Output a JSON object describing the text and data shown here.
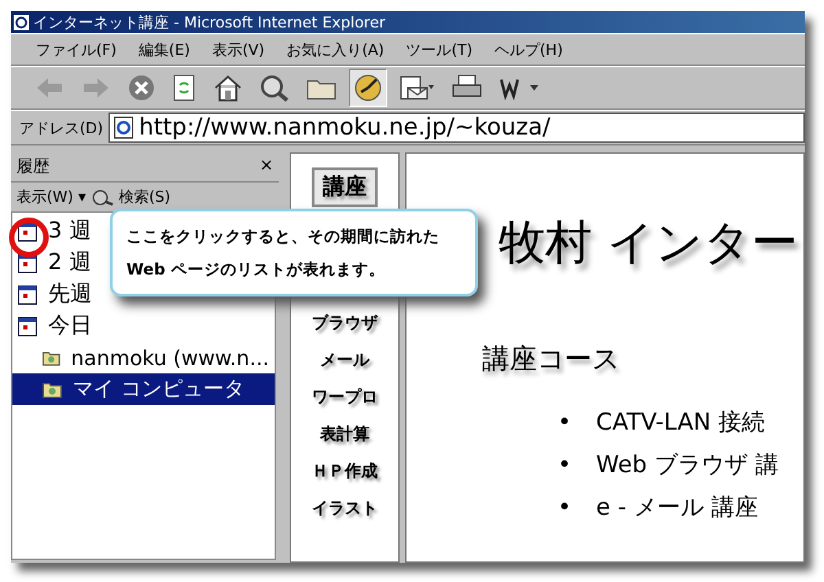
{
  "window": {
    "title": "インターネット講座 - Microsoft Internet Explorer"
  },
  "menu": [
    "ファイル(F)",
    "編集(E)",
    "表示(V)",
    "お気に入り(A)",
    "ツール(T)",
    "ヘルプ(H)"
  ],
  "toolbar": [
    {
      "kind": "back",
      "selected": false
    },
    {
      "kind": "forward",
      "selected": false
    },
    {
      "kind": "stop",
      "selected": false
    },
    {
      "kind": "refresh",
      "selected": false
    },
    {
      "kind": "home",
      "selected": false
    },
    {
      "kind": "search",
      "selected": false
    },
    {
      "kind": "favorites",
      "selected": false
    },
    {
      "kind": "history",
      "selected": true
    },
    {
      "kind": "mail",
      "selected": false
    },
    {
      "kind": "print",
      "selected": false
    },
    {
      "kind": "edit",
      "selected": false
    }
  ],
  "address_bar": {
    "label": "アドレス(D)",
    "url": "http://www.nanmoku.ne.jp/~kouza/"
  },
  "history_pane": {
    "title": "履歴",
    "close": "×",
    "view_button": "表示(W)",
    "view_caret": "▾",
    "search_button": "検索(S)",
    "items": [
      {
        "label": "3 週",
        "kind": "week",
        "selected": false
      },
      {
        "label": "2 週",
        "kind": "week",
        "selected": false
      },
      {
        "label": "先週",
        "kind": "week",
        "selected": false
      },
      {
        "label": "今日",
        "kind": "week",
        "selected": false,
        "children": [
          {
            "label": "nanmoku (www.n...",
            "kind": "site",
            "selected": false
          },
          {
            "label": "マイ コンピュータ",
            "kind": "site",
            "selected": true
          }
        ]
      }
    ]
  },
  "nav_frame": {
    "items": [
      {
        "label": "講座",
        "selected": true
      },
      {
        "label": "ブラウザ",
        "selected": false
      },
      {
        "label": "メール",
        "selected": false
      },
      {
        "label": "ワープロ",
        "selected": false
      },
      {
        "label": "表計算",
        "selected": false
      },
      {
        "label": "ＨＰ作成",
        "selected": false
      },
      {
        "label": "イラスト",
        "selected": false
      }
    ]
  },
  "page": {
    "heading": "牧村 インター",
    "subheading": "講座コース",
    "courses": [
      {
        "bullet": "•",
        "label": "CATV-LAN 接続"
      },
      {
        "bullet": "•",
        "label": "Web ブラウザ 講"
      },
      {
        "bullet": "•",
        "label": "e - メール 講座"
      }
    ]
  },
  "callout": {
    "lines": [
      "ここをクリックすると、その期間に訪れた",
      "Web ページのリストが表れます。"
    ]
  }
}
